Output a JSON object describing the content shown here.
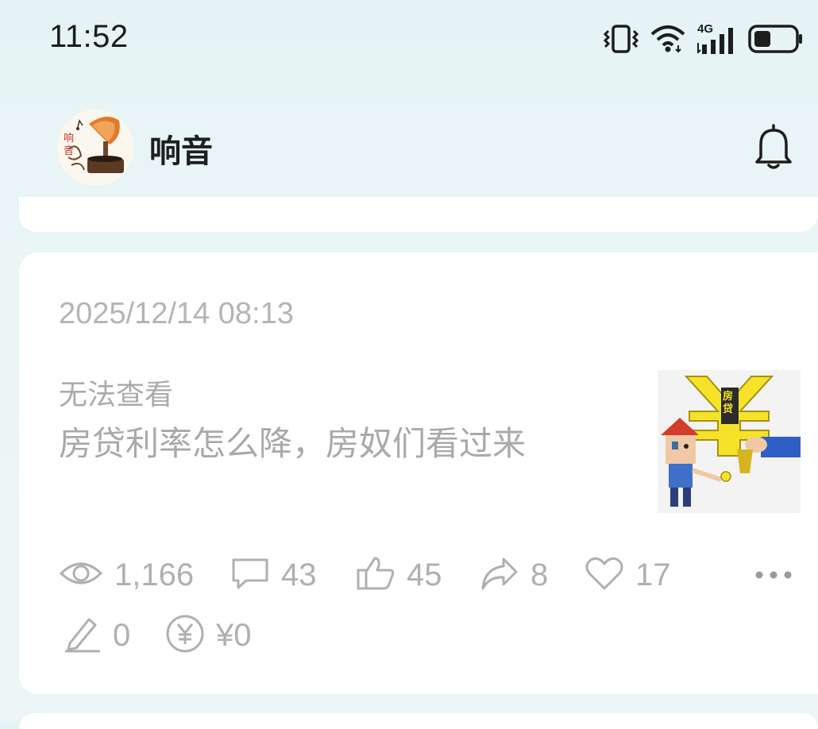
{
  "status_bar": {
    "time": "11:52",
    "network_label": "4G",
    "icons": [
      "vibrate-icon",
      "wifi-icon",
      "cellular-4g-icon",
      "battery-icon"
    ]
  },
  "header": {
    "channel_name": "响音",
    "avatar_icon": "gramophone-avatar",
    "bell_icon": "bell-icon"
  },
  "post": {
    "timestamp": "2025/12/14 08:13",
    "status": "无法查看",
    "title": "房贷利率怎么降，房奴们看过来",
    "thumbnail_icon": "mortgage-cartoon-thumbnail",
    "thumbnail_text": "房贷",
    "stats": {
      "views": "1,166",
      "comments": "43",
      "likes": "45",
      "shares": "8",
      "favorites": "17",
      "edits": "0",
      "earnings": "¥0"
    },
    "stat_icons": [
      "eye-icon",
      "comment-icon",
      "thumbs-up-icon",
      "share-icon",
      "heart-icon",
      "pencil-icon",
      "yuan-icon",
      "more-icon"
    ]
  },
  "colors": {
    "background": "#e8f4f5",
    "card": "#ffffff",
    "muted_text": "#b0b0b0",
    "primary_text": "#1e1e1e"
  }
}
